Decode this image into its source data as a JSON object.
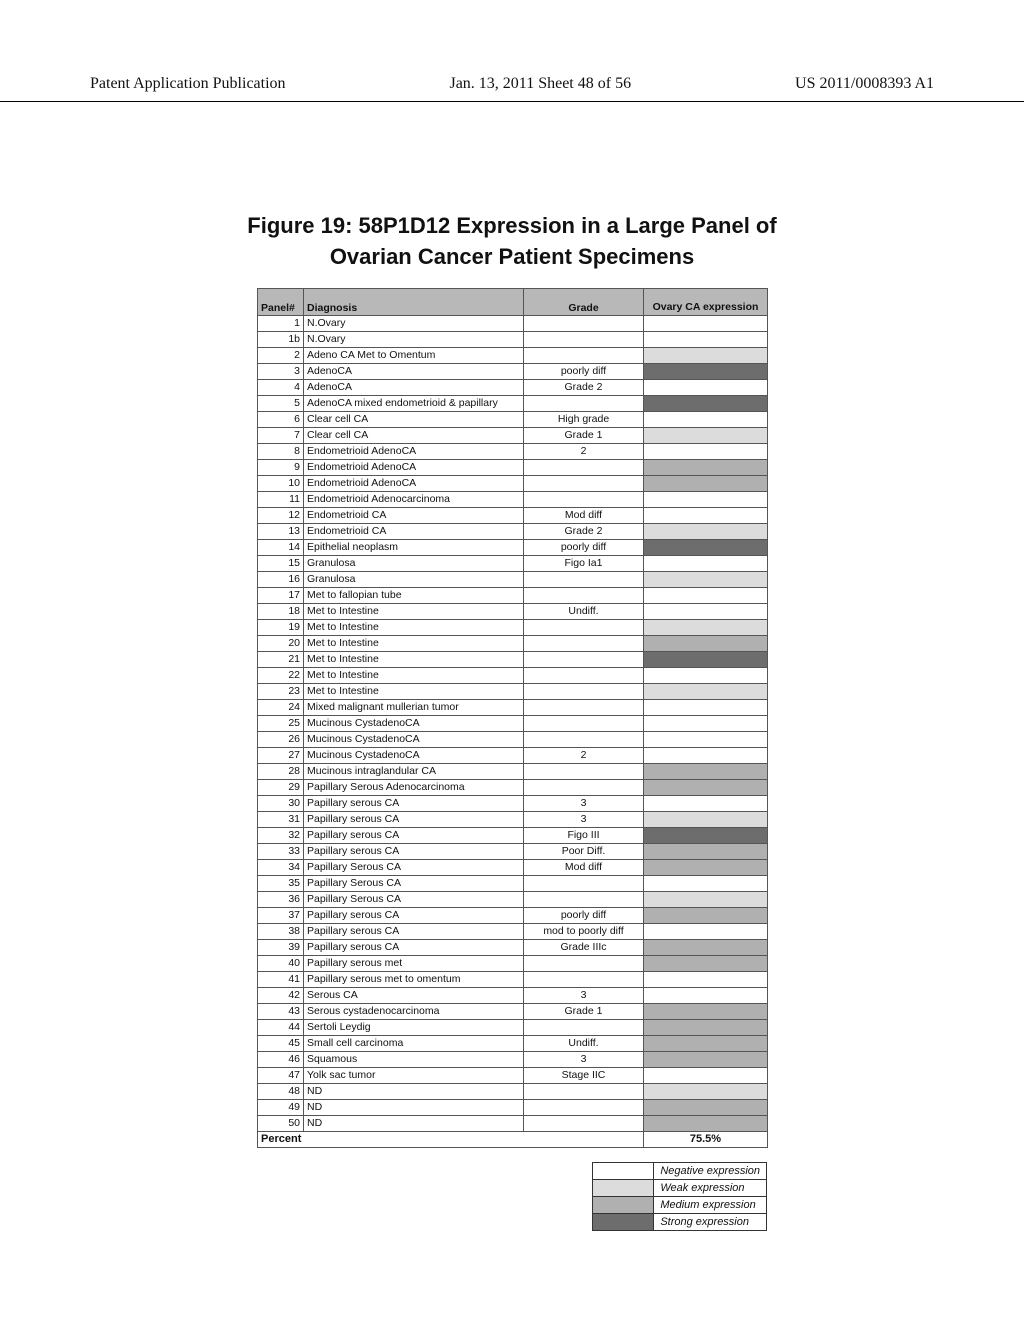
{
  "header": {
    "left": "Patent Application Publication",
    "center": "Jan. 13, 2011  Sheet 48 of 56",
    "right": "US 2011/0008393 A1"
  },
  "figure": {
    "title_line1": "Figure 19:   58P1D12 Expression in a Large Panel of",
    "title_line2": "Ovarian Cancer Patient Specimens"
  },
  "columns": {
    "panel": "Panel#",
    "diagnosis": "Diagnosis",
    "grade": "Grade",
    "expression": "Ovary CA expression"
  },
  "rows": [
    {
      "panel": "1",
      "diagnosis": "N.Ovary",
      "grade": "",
      "level": 0
    },
    {
      "panel": "1b",
      "diagnosis": "N.Ovary",
      "grade": "",
      "level": 0
    },
    {
      "panel": "2",
      "diagnosis": "Adeno CA Met to Omentum",
      "grade": "",
      "level": 1
    },
    {
      "panel": "3",
      "diagnosis": "AdenoCA",
      "grade": "poorly diff",
      "level": 3
    },
    {
      "panel": "4",
      "diagnosis": "AdenoCA",
      "grade": "Grade 2",
      "level": 0
    },
    {
      "panel": "5",
      "diagnosis": "AdenoCA mixed endometrioid & papillary",
      "grade": "",
      "level": 3
    },
    {
      "panel": "6",
      "diagnosis": "Clear cell CA",
      "grade": "High grade",
      "level": 0
    },
    {
      "panel": "7",
      "diagnosis": "Clear cell CA",
      "grade": "Grade 1",
      "level": 1
    },
    {
      "panel": "8",
      "diagnosis": "Endometrioid AdenoCA",
      "grade": "2",
      "level": 0
    },
    {
      "panel": "9",
      "diagnosis": "Endometrioid AdenoCA",
      "grade": "",
      "level": 2
    },
    {
      "panel": "10",
      "diagnosis": "Endometrioid AdenoCA",
      "grade": "",
      "level": 2
    },
    {
      "panel": "11",
      "diagnosis": "Endometrioid Adenocarcinoma",
      "grade": "",
      "level": 0
    },
    {
      "panel": "12",
      "diagnosis": "Endometrioid CA",
      "grade": "Mod diff",
      "level": 0
    },
    {
      "panel": "13",
      "diagnosis": "Endometrioid CA",
      "grade": "Grade 2",
      "level": 1
    },
    {
      "panel": "14",
      "diagnosis": "Epithelial neoplasm",
      "grade": "poorly diff",
      "level": 3
    },
    {
      "panel": "15",
      "diagnosis": "Granulosa",
      "grade": "Figo Ia1",
      "level": 0
    },
    {
      "panel": "16",
      "diagnosis": "Granulosa",
      "grade": "",
      "level": 1
    },
    {
      "panel": "17",
      "diagnosis": "Met to fallopian tube",
      "grade": "",
      "level": 0
    },
    {
      "panel": "18",
      "diagnosis": "Met to Intestine",
      "grade": "Undiff.",
      "level": 0
    },
    {
      "panel": "19",
      "diagnosis": "Met to Intestine",
      "grade": "",
      "level": 1
    },
    {
      "panel": "20",
      "diagnosis": "Met to Intestine",
      "grade": "",
      "level": 2
    },
    {
      "panel": "21",
      "diagnosis": "Met to Intestine",
      "grade": "",
      "level": 3
    },
    {
      "panel": "22",
      "diagnosis": "Met to Intestine",
      "grade": "",
      "level": 0
    },
    {
      "panel": "23",
      "diagnosis": "Met to Intestine",
      "grade": "",
      "level": 1
    },
    {
      "panel": "24",
      "diagnosis": "Mixed malignant mullerian tumor",
      "grade": "",
      "level": 0
    },
    {
      "panel": "25",
      "diagnosis": "Mucinous CystadenoCA",
      "grade": "",
      "level": 0
    },
    {
      "panel": "26",
      "diagnosis": "Mucinous CystadenoCA",
      "grade": "",
      "level": 0
    },
    {
      "panel": "27",
      "diagnosis": "Mucinous CystadenoCA",
      "grade": "2",
      "level": 0
    },
    {
      "panel": "28",
      "diagnosis": "Mucinous intraglandular CA",
      "grade": "",
      "level": 2
    },
    {
      "panel": "29",
      "diagnosis": "Papillary Serous Adenocarcinoma",
      "grade": "",
      "level": 2
    },
    {
      "panel": "30",
      "diagnosis": "Papillary serous CA",
      "grade": "3",
      "level": 0
    },
    {
      "panel": "31",
      "diagnosis": "Papillary serous CA",
      "grade": "3",
      "level": 1
    },
    {
      "panel": "32",
      "diagnosis": "Papillary serous CA",
      "grade": "Figo III",
      "level": 3
    },
    {
      "panel": "33",
      "diagnosis": "Papillary serous CA",
      "grade": "Poor Diff.",
      "level": 2
    },
    {
      "panel": "34",
      "diagnosis": "Papillary Serous CA",
      "grade": "Mod diff",
      "level": 2
    },
    {
      "panel": "35",
      "diagnosis": "Papillary Serous CA",
      "grade": "",
      "level": 0
    },
    {
      "panel": "36",
      "diagnosis": "Papillary Serous CA",
      "grade": "",
      "level": 1
    },
    {
      "panel": "37",
      "diagnosis": "Papillary serous CA",
      "grade": "poorly diff",
      "level": 2
    },
    {
      "panel": "38",
      "diagnosis": "Papillary serous CA",
      "grade": "mod to poorly diff",
      "level": 0
    },
    {
      "panel": "39",
      "diagnosis": "Papillary serous CA",
      "grade": "Grade IIIc",
      "level": 2
    },
    {
      "panel": "40",
      "diagnosis": "Papillary serous met",
      "grade": "",
      "level": 2
    },
    {
      "panel": "41",
      "diagnosis": "Papillary serous met to omentum",
      "grade": "",
      "level": 0
    },
    {
      "panel": "42",
      "diagnosis": "Serous CA",
      "grade": "3",
      "level": 0
    },
    {
      "panel": "43",
      "diagnosis": "Serous cystadenocarcinoma",
      "grade": "Grade 1",
      "level": 2
    },
    {
      "panel": "44",
      "diagnosis": "Sertoli Leydig",
      "grade": "",
      "level": 2
    },
    {
      "panel": "45",
      "diagnosis": "Small cell carcinoma",
      "grade": "Undiff.",
      "level": 2
    },
    {
      "panel": "46",
      "diagnosis": "Squamous",
      "grade": "3",
      "level": 2
    },
    {
      "panel": "47",
      "diagnosis": "Yolk sac tumor",
      "grade": "Stage IIC",
      "level": 0
    },
    {
      "panel": "48",
      "diagnosis": "ND",
      "grade": "",
      "level": 1
    },
    {
      "panel": "49",
      "diagnosis": "ND",
      "grade": "",
      "level": 2
    },
    {
      "panel": "50",
      "diagnosis": "ND",
      "grade": "",
      "level": 2
    }
  ],
  "percent": {
    "label": "Percent",
    "value": "75.5%"
  },
  "legend": [
    {
      "level": 0,
      "label": "Negative expression"
    },
    {
      "level": 1,
      "label": "Weak expression"
    },
    {
      "level": 2,
      "label": "Medium expression"
    },
    {
      "level": 3,
      "label": "Strong expression"
    }
  ],
  "chart_data": {
    "type": "table",
    "title": "58P1D12 Expression in a Large Panel of Ovarian Cancer Patient Specimens",
    "expression_scale": {
      "0": "Negative",
      "1": "Weak",
      "2": "Medium",
      "3": "Strong"
    },
    "percent_positive": 75.5
  }
}
